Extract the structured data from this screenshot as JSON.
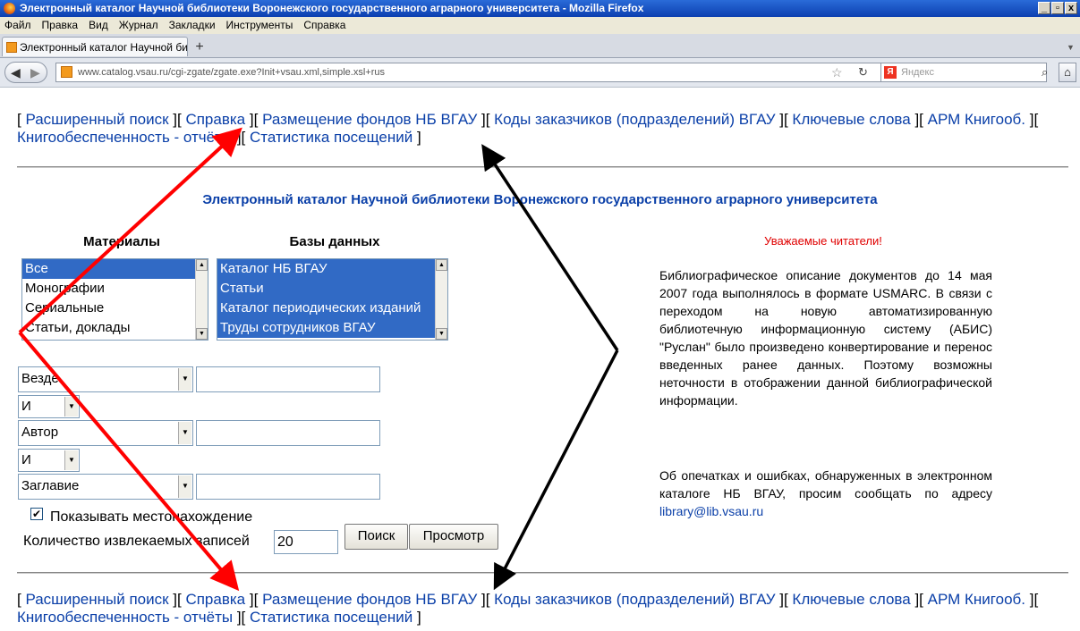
{
  "window": {
    "title": "Электронный каталог Научной библиотеки Воронежского государственного аграрного университета - Mozilla Firefox",
    "controls": [
      "_",
      "▫",
      "x"
    ]
  },
  "menu": [
    "Файл",
    "Правка",
    "Вид",
    "Журнал",
    "Закладки",
    "Инструменты",
    "Справка"
  ],
  "tab": {
    "label": "Электронный каталог Научной библиоте...",
    "new_tab": "+"
  },
  "address": {
    "url": "www.catalog.vsau.ru/cgi-zgate/zgate.exe?Init+vsau.xml,simple.xsl+rus",
    "search_placeholder": "Яндекс"
  },
  "nav_links": [
    "Расширенный поиск",
    "Справка",
    "Размещение фондов НБ ВГАУ",
    "Коды заказчиков (подразделений) ВГАУ",
    "Ключевые слова",
    "АРМ Книгооб.",
    "Книгообеспеченность - отчёты",
    "Статистика посещений"
  ],
  "page_title": "Электронный каталог Научной библиотеки Воронежского государственного аграрного университета",
  "materials": {
    "header": "Материалы",
    "items": [
      "Все",
      "Монографии",
      "Сериальные",
      "Статьи, доклады"
    ],
    "selected": [
      "Все"
    ]
  },
  "databases": {
    "header": "Базы данных",
    "items": [
      "Каталог НБ ВГАУ",
      "Статьи",
      "Каталог периодических изданий",
      "Труды сотрудников ВГАУ"
    ],
    "selected": [
      "Каталог НБ ВГАУ",
      "Статьи",
      "Каталог периодических изданий",
      "Труды сотрудников ВГАУ"
    ]
  },
  "search_rows": {
    "field1": "Везде",
    "op1": "И",
    "field2": "Автор",
    "op2": "И",
    "field3": "Заглавие"
  },
  "show_location": {
    "label": "Показывать местонахождение",
    "checked": true
  },
  "records_count": {
    "label": "Количество извлекаемых записей",
    "value": "20"
  },
  "buttons": {
    "search": "Поиск",
    "browse": "Просмотр"
  },
  "notice": {
    "title": "Уважаемые читатели!",
    "p1": "Библиографическое описание документов до 14 мая 2007 года выполнялось в формате USMARC. В связи с переходом на новую автоматизированную библиотечную информационную систему (АБИС) \"Руслан\" было произведено конвертирование и перенос введенных ранее данных. Поэтому возможны неточности в отображении данной библиографической информации.",
    "p2": "Об опечатках и ошибках, обнаруженных в электронном каталоге НБ ВГАУ, просим сообщать по адресу",
    "email": "library@lib.vsau.ru"
  },
  "colors": {
    "link": "#0a3fa8",
    "notice_title": "#e00000",
    "selection": "#316ac5",
    "arrow_red": "#ff0000",
    "arrow_black": "#000000"
  }
}
